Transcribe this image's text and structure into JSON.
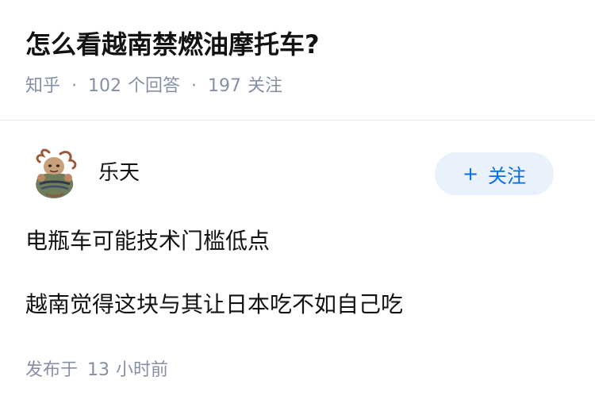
{
  "question": {
    "title": "怎么看越南禁燃油摩托车?",
    "source": "知乎",
    "separator": "·",
    "answer_count": "102",
    "answer_label": "个回答",
    "follower_count": "197",
    "follower_label": "关注"
  },
  "answer": {
    "author": {
      "name": "乐天",
      "avatar_icon": "avatar-illustration"
    },
    "follow_button": {
      "plus": "+",
      "label": "关注"
    },
    "paragraphs": [
      "电瓶车可能技术门槛低点",
      "越南觉得这块与其让日本吃不如自己吃"
    ],
    "published": {
      "prefix": "发布于",
      "amount": "13",
      "unit": "小时前"
    }
  },
  "colors": {
    "text": "#121212",
    "meta": "#8590a6",
    "accent": "#056de8",
    "button_bg": "#e8f1fc",
    "divider": "#ebebeb"
  }
}
